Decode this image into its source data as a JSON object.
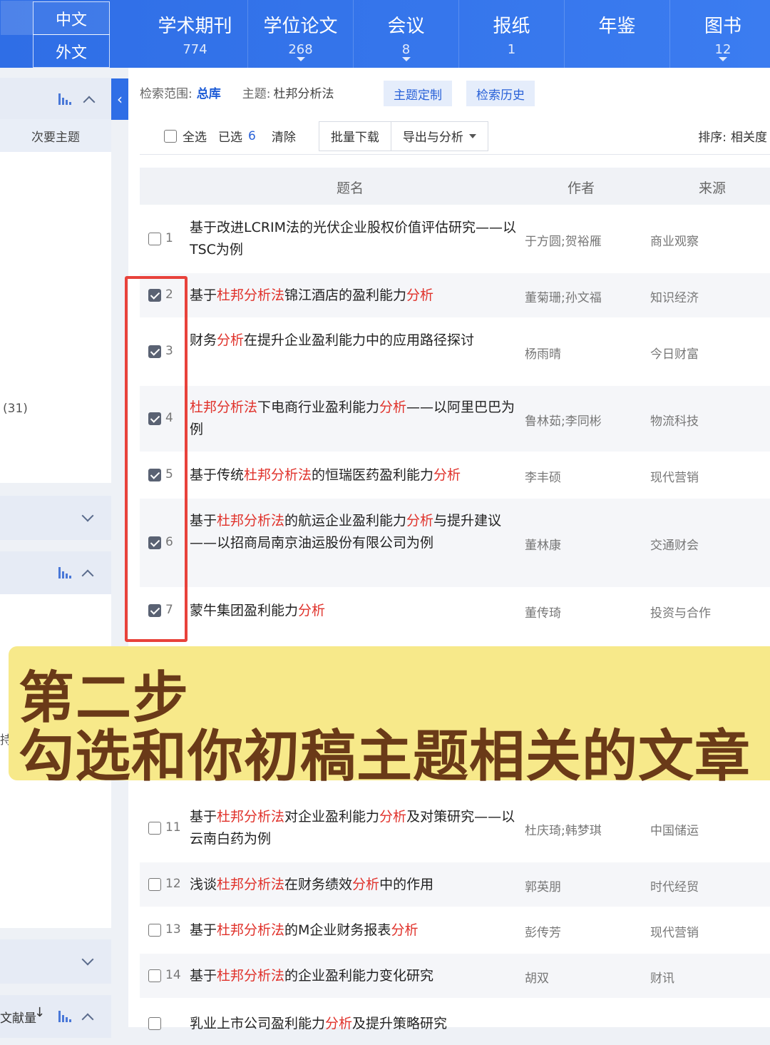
{
  "nav": {
    "lang_zh": "中文",
    "lang_en": "外文",
    "tabs": [
      {
        "label": "学术期刊",
        "count": "774"
      },
      {
        "label": "学位论文",
        "count": "268"
      },
      {
        "label": "会议",
        "count": "8"
      },
      {
        "label": "报纸",
        "count": "1"
      },
      {
        "label": "年鉴",
        "count": ""
      },
      {
        "label": "图书",
        "count": "12"
      }
    ]
  },
  "sidebar": {
    "secondary_topic": "次要主题",
    "count_fragment": "(31)",
    "partial_label_1": "持",
    "partial_label_2": "文献量"
  },
  "search": {
    "scope_label": "检索范围:",
    "scope_value": "总库",
    "topic_label": "主题:",
    "topic_value": "杜邦分析法",
    "customize_button": "主题定制",
    "history_button": "检索历史"
  },
  "toolbar": {
    "select_all": "全选",
    "selected_label": "已选",
    "selected_count": "6",
    "clear": "清除",
    "batch_download": "批量下载",
    "export_analyze": "导出与分析",
    "sort_label": "排序:",
    "sort_value": "相关度"
  },
  "table": {
    "headers": {
      "title": "题名",
      "author": "作者",
      "source": "来源"
    },
    "rows": [
      {
        "num": "1",
        "checked": false,
        "title_html": "基于改进LCRIM法的光伏企业股权价值评估研究——以TSC为例",
        "author": "于方圆;贺裕雁",
        "source": "商业观察"
      },
      {
        "num": "2",
        "checked": true,
        "title_html": "基于<span class='hl'>杜邦分析法</span>锦江酒店的盈利能力<span class='hl'>分析</span>",
        "author": "董菊珊;孙文福",
        "source": "知识经济"
      },
      {
        "num": "3",
        "checked": true,
        "title_html": "财务<span class='hl'>分析</span>在提升企业盈利能力中的应用路径探讨",
        "author": "杨雨晴",
        "source": "今日财富"
      },
      {
        "num": "4",
        "checked": true,
        "title_html": "<span class='hl'>杜邦分析法</span>下电商行业盈利能力<span class='hl'>分析</span>——以阿里巴巴为例",
        "author": "鲁林茹;李同彬",
        "source": "物流科技"
      },
      {
        "num": "5",
        "checked": true,
        "title_html": "基于传统<span class='hl'>杜邦分析法</span>的恒瑞医药盈利能力<span class='hl'>分析</span>",
        "author": "李丰硕",
        "source": "现代营销"
      },
      {
        "num": "6",
        "checked": true,
        "title_html": "基于<span class='hl'>杜邦分析法</span>的航运企业盈利能力<span class='hl'>分析</span>与提升建议——以招商局南京油运股份有限公司为例",
        "author": "董林康",
        "source": "交通财会"
      },
      {
        "num": "7",
        "checked": true,
        "title_html": "蒙牛集团盈利能力<span class='hl'>分析</span>",
        "author": "董传琦",
        "source": "投资与合作"
      },
      {
        "num": "11",
        "checked": false,
        "title_html": "基于<span class='hl'>杜邦分析法</span>对企业盈利能力<span class='hl'>分析</span>及对策研究——以云南白药为例",
        "author": "杜庆琦;韩梦琪",
        "source": "中国储运"
      },
      {
        "num": "12",
        "checked": false,
        "title_html": "浅谈<span class='hl'>杜邦分析法</span>在财务绩效<span class='hl'>分析</span>中的作用",
        "author": "郭英朋",
        "source": "时代经贸"
      },
      {
        "num": "13",
        "checked": false,
        "title_html": "基于<span class='hl'>杜邦分析法</span>的M企业财务报表<span class='hl'>分析</span>",
        "author": "彭传芳",
        "source": "现代营销"
      },
      {
        "num": "14",
        "checked": false,
        "title_html": "基于<span class='hl'>杜邦分析法</span>的企业盈利能力变化研究",
        "author": "胡双",
        "source": "财讯"
      },
      {
        "num": "",
        "checked": false,
        "title_html": "乳业上市公司盈利能力<span class='hl'>分析</span>及提升策略研究",
        "author": "",
        "source": ""
      }
    ]
  },
  "banner": {
    "line1": "第二步",
    "line2": "勾选和你初稿主题相关的文章"
  },
  "colors": {
    "primary": "#2f6ee6",
    "highlight": "#e0322b",
    "banner_bg": "#f7e98a",
    "banner_text": "#6a3a18",
    "red_box": "#e8423b"
  }
}
